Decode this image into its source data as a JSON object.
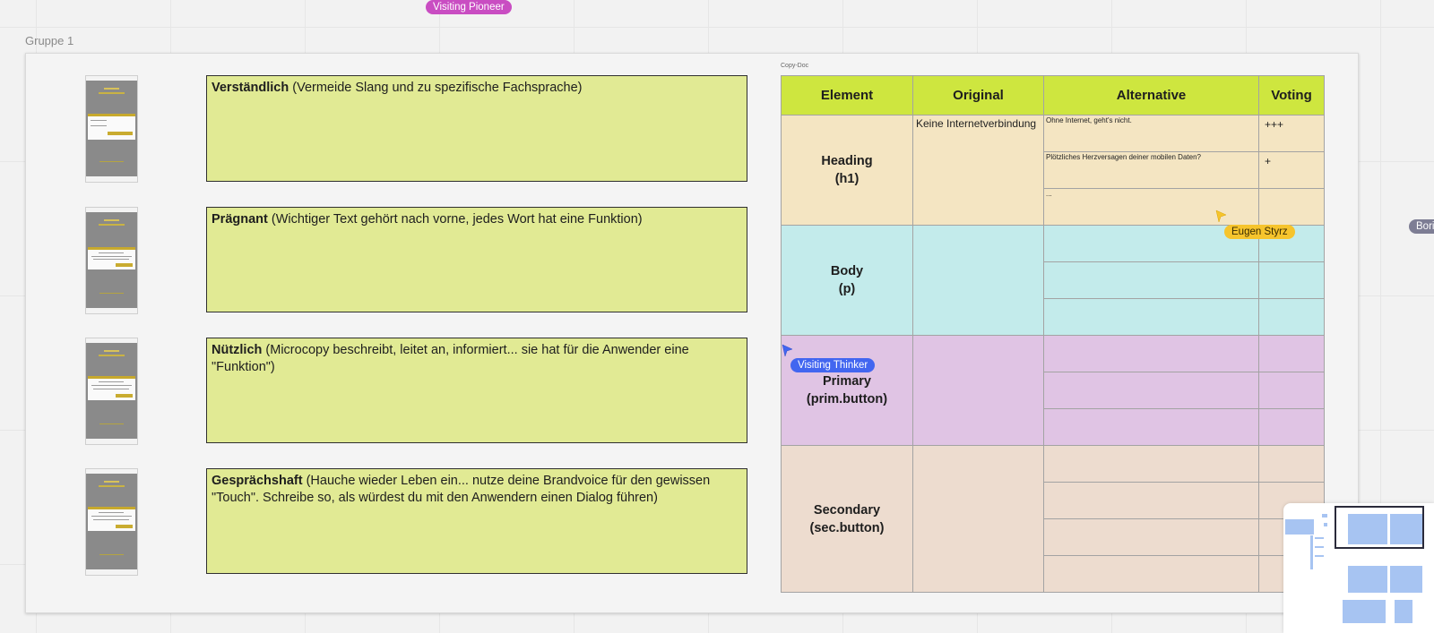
{
  "group_label": "Gruppe 1",
  "collaborators": [
    {
      "name": "Visiting Pioneer",
      "color": "#c94dc2"
    },
    {
      "name": "Eugen Styrz",
      "color": "#f6c42c"
    },
    {
      "name": "Visiting Thinker",
      "color": "#4266f0"
    },
    {
      "name": "Bori",
      "color": "#7d7d94"
    }
  ],
  "notes": [
    {
      "title": "Verständlich",
      "text": " (Vermeide Slang und zu spezifische Fachsprache)"
    },
    {
      "title": "Prägnant",
      "text": " (Wichtiger Text gehört nach vorne, jedes Wort hat eine Funktion)"
    },
    {
      "title": "Nützlich",
      "text": " (Microcopy beschreibt, leitet an, informiert... sie hat für die Anwender eine \"Funktion\")"
    },
    {
      "title": "Gesprächshaft",
      "text": " (Hauche wieder Leben ein... nutze deine Brandvoice für den gewissen \"Touch\". Schreibe so, als würdest du mit den Anwendern einen Dialog führen)"
    }
  ],
  "copy_doc": {
    "label": "Copy-Doc",
    "headers": [
      "Element",
      "Original",
      "Alternative",
      "Voting"
    ],
    "rows": [
      {
        "element": "Heading",
        "element_sub": "(h1)",
        "original": "Keine Internetverbindung",
        "alternatives": [
          "Ohne Internet, geht's nicht.",
          "Plötzliches Herzversagen deiner mobilen Daten?",
          "..."
        ],
        "votes": [
          "+++",
          "+",
          ""
        ]
      },
      {
        "element": "Body",
        "element_sub": "(p)",
        "original": "",
        "alternatives": [
          "",
          "",
          ""
        ],
        "votes": [
          "",
          "",
          ""
        ]
      },
      {
        "element": "Primary",
        "element_sub": "(prim.button)",
        "original": "",
        "alternatives": [
          "",
          "",
          ""
        ],
        "votes": [
          "",
          "",
          ""
        ]
      },
      {
        "element": "Secondary",
        "element_sub": "(sec.button)",
        "original": "",
        "alternatives": [
          "",
          "",
          "",
          ""
        ],
        "votes": [
          "",
          "",
          "",
          ""
        ]
      }
    ]
  },
  "colors": {
    "note_bg": "#e1ea94",
    "table_header": "#cee63f",
    "heading_row": "#f4e5c2",
    "body_row": "#c3ebeb",
    "primary_row": "#e0c4e4",
    "secondary_row": "#eddccf"
  }
}
